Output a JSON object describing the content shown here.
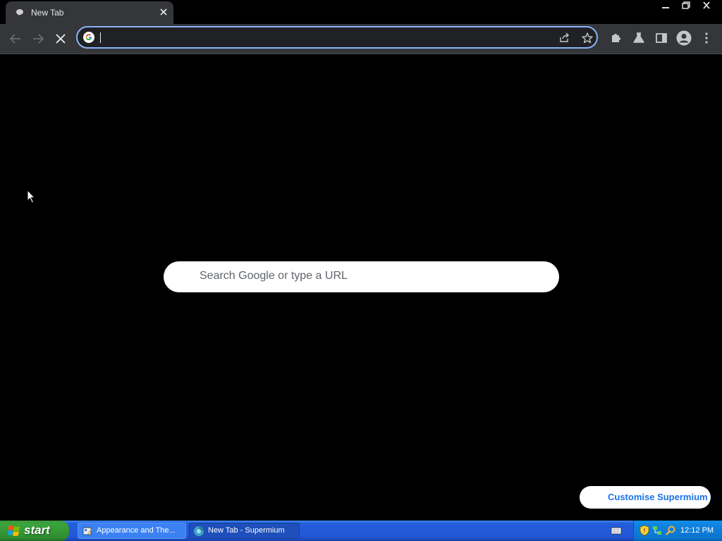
{
  "browser": {
    "tab": {
      "title": "New Tab"
    },
    "omnibox": {
      "value": ""
    }
  },
  "ntp": {
    "search_placeholder": "Search Google or type a URL",
    "customise_label": "Customise Supermium"
  },
  "taskbar": {
    "start_label": "start",
    "tasks": [
      {
        "label": "Appearance and The..."
      },
      {
        "label": "New Tab - Supermium"
      }
    ],
    "clock": "12:12 PM"
  },
  "colors": {
    "accent": "#8ab4f8",
    "toolbar": "#35363a",
    "page_bg": "#000000",
    "link_blue": "#1a73e8",
    "taskbar_blue": "#245edb",
    "start_green": "#3aa43a"
  }
}
